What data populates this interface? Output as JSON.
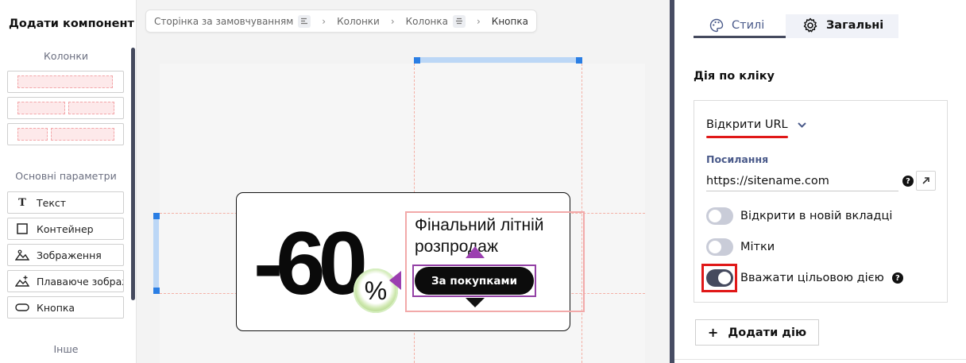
{
  "left_panel": {
    "title": "Додати компонент",
    "section_columns": "Колонки",
    "section_basic": "Основні параметри",
    "section_other": "Інше",
    "components": [
      {
        "label": "Текст",
        "icon": "text-icon"
      },
      {
        "label": "Контейнер",
        "icon": "container-icon"
      },
      {
        "label": "Зображення",
        "icon": "image-icon"
      },
      {
        "label": "Плаваюче зображення",
        "icon": "floating-image-icon"
      },
      {
        "label": "Кнопка",
        "icon": "button-icon"
      }
    ]
  },
  "breadcrumb": {
    "items": [
      "Сторінка за замовчуванням",
      "Колонки",
      "Колонка",
      "Кнопка"
    ]
  },
  "canvas": {
    "discount": "-60",
    "percent": "%",
    "headline_line1": "Фінальний літній",
    "headline_line2": "розпродаж",
    "cta_label": "За покупками"
  },
  "right_panel": {
    "tabs": [
      {
        "label": "Стилі",
        "icon": "palette-icon",
        "active": false
      },
      {
        "label": "Загальні",
        "icon": "gear-icon",
        "active": true
      }
    ],
    "section_title": "Дія по кліку",
    "action_type": "Відкрити URL",
    "link_label": "Посилання",
    "link_value": "https://sitename.com",
    "toggles": [
      {
        "label": "Відкрити в новій вкладці",
        "on": false
      },
      {
        "label": "Мітки",
        "on": false
      },
      {
        "label": "Вважати цільовою дією",
        "on": true
      }
    ],
    "add_action_label": "Додати дію"
  },
  "colors": {
    "accent_dark": "#454a5e",
    "highlight_red": "#e01818",
    "selection_purple": "#9b3fb0",
    "selection_blue": "#2a7ee4"
  }
}
